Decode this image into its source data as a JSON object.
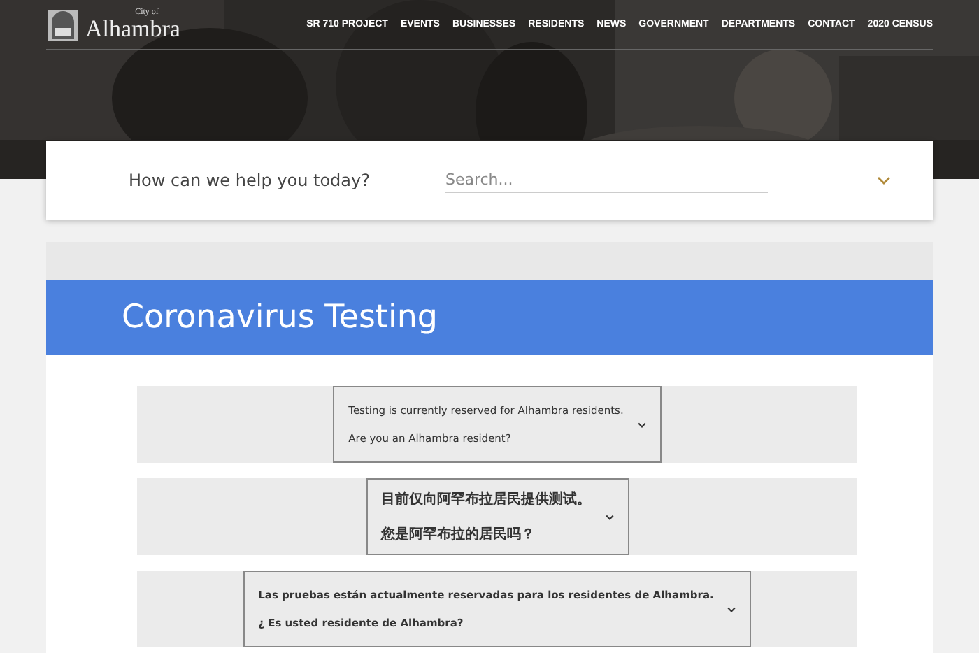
{
  "header": {
    "logo_small": "City of",
    "logo_name": "Alhambra",
    "nav": [
      "SR 710 PROJECT",
      "EVENTS",
      "BUSINESSES",
      "RESIDENTS",
      "NEWS",
      "GOVERNMENT",
      "DEPARTMENTS",
      "CONTACT",
      "2020 CENSUS"
    ]
  },
  "search": {
    "prompt": "How can we help you today?",
    "placeholder": "Search..."
  },
  "banner": {
    "title": "Coronavirus Testing"
  },
  "questions": [
    {
      "kind": "latin",
      "lines": [
        "Testing is currently reserved for Alhambra residents.",
        "Are you an Alhambra resident?"
      ],
      "bold": false
    },
    {
      "kind": "cjk",
      "lines": [
        "目前仅向阿罕布拉居民提供测试。",
        "您是阿罕布拉的居民吗？"
      ],
      "bold": true
    },
    {
      "kind": "latin",
      "lines": [
        "Las pruebas están actualmente reservadas para los residentes de Alhambra.",
        "¿ Es usted residente de Alhambra?"
      ],
      "bold": true
    }
  ]
}
